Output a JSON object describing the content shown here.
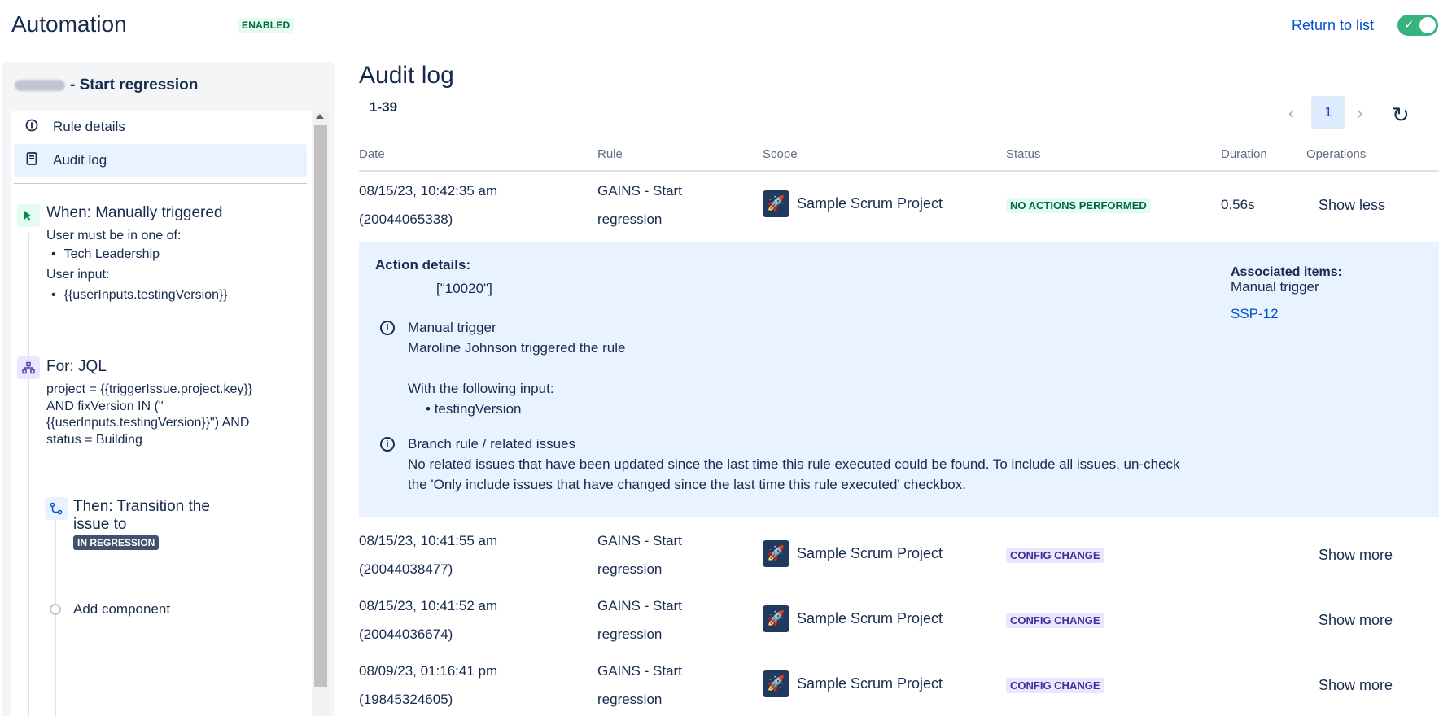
{
  "header": {
    "title": "Automation",
    "status_badge": "ENABLED",
    "return_link": "Return to list",
    "toggle_check": "✓"
  },
  "sidebar": {
    "rule_name": "- Start regression",
    "nav": [
      {
        "label": "Rule details",
        "icon": "info-icon"
      },
      {
        "label": "Audit log",
        "icon": "document-icon"
      }
    ],
    "components": {
      "trigger": {
        "title": "When: Manually triggered",
        "line1": "User must be in one of:",
        "group": "Tech Leadership",
        "line2": "User input:",
        "input": "{{userInputs.testingVersion}}"
      },
      "branch": {
        "title": "For: JQL",
        "jql_1": "project = {{triggerIssue.project.key}}",
        "jql_2": "AND fixVersion IN (\"",
        "jql_3": "{{userInputs.testingVersion}}\") AND",
        "jql_4": "status = Building"
      },
      "action": {
        "title_1": "Then: Transition the",
        "title_2": "issue to",
        "status": "IN REGRESSION"
      },
      "add": "Add component"
    }
  },
  "main": {
    "title": "Audit log",
    "range": "1-39",
    "pager": {
      "prev": "‹",
      "page": "1",
      "next": "›",
      "refresh": "↻"
    },
    "columns": [
      "Date",
      "Rule",
      "Scope",
      "Status",
      "Duration",
      "Operations"
    ],
    "rows": [
      {
        "date": "08/15/23, 10:42:35 am",
        "id": "(20044065338)",
        "rule_1": "GAINS - Start",
        "rule_2": "regression",
        "scope": "Sample Scrum Project",
        "status": "NO ACTIONS PERFORMED",
        "duration": "0.56s",
        "op": "Show less"
      },
      {
        "date": "08/15/23, 10:41:55 am",
        "id": "(20044038477)",
        "rule_1": "GAINS - Start",
        "rule_2": "regression",
        "scope": "Sample Scrum Project",
        "status": "CONFIG CHANGE",
        "duration": "",
        "op": "Show more"
      },
      {
        "date": "08/15/23, 10:41:52 am",
        "id": "(20044036674)",
        "rule_1": "GAINS - Start",
        "rule_2": "regression",
        "scope": "Sample Scrum Project",
        "status": "CONFIG CHANGE",
        "duration": "",
        "op": "Show more"
      },
      {
        "date": "08/09/23, 01:16:41 pm",
        "id": "(19845324605)",
        "rule_1": "GAINS - Start",
        "rule_2": "regression",
        "scope": "Sample Scrum Project",
        "status": "CONFIG CHANGE",
        "duration": "",
        "op": "Show more"
      }
    ],
    "details": {
      "action_label": "Action details:",
      "action_value": "[\"10020\"]",
      "trigger_title": "Manual trigger",
      "trigger_text": "Maroline Johnson triggered the rule",
      "input_text": "With the following input:",
      "input_item": "testingVersion",
      "branch_title": "Branch rule / related issues",
      "branch_text_1": "No related issues that have been updated since the last time this rule executed could be found. To include all issues, un-check",
      "branch_text_2": "the 'Only include issues that have changed since the last time this rule executed' checkbox.",
      "assoc_label": "Associated items:",
      "assoc_trigger": "Manual trigger",
      "assoc_link": "SSP-12"
    }
  },
  "colors": {
    "accent": "#0052cc",
    "enabled": "#36b37e",
    "details_bg": "#e9f2ff"
  }
}
